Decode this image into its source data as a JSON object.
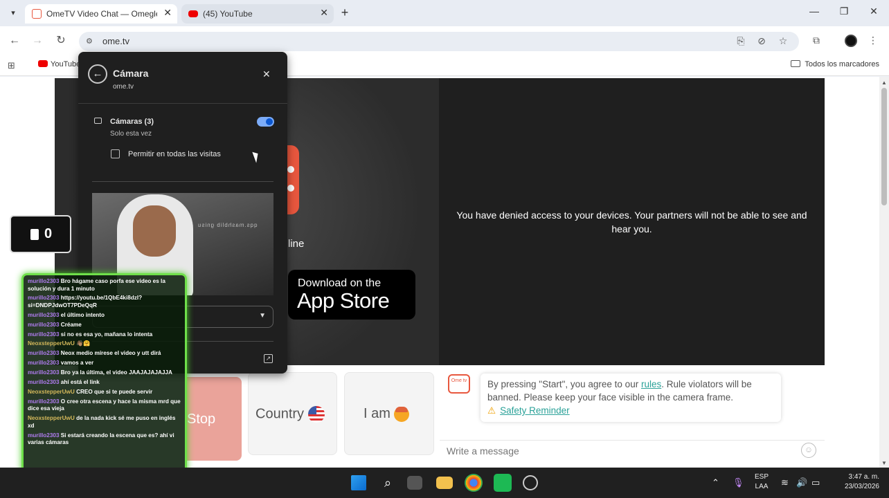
{
  "browser": {
    "tabs": [
      {
        "title": "OmeTV Video Chat — Omegle"
      },
      {
        "title": "(45) YouTube"
      }
    ],
    "url": "ome.tv",
    "bookmarks": {
      "youtube_label": "YouTube",
      "all_bookmarks": "Todos los marcadores"
    }
  },
  "permission_popup": {
    "title": "Cámara",
    "host": "ome.tv",
    "cameras_label": "Cámaras (3)",
    "cameras_sub": "Solo esta vez",
    "cameras_enabled": true,
    "allow_always_label": "Permitir en todas las visitas",
    "allow_always_checked": false,
    "preview_mirrored_text": "qqs.mashblib gnisu"
  },
  "page": {
    "denied_message": "You have denied access to your devices. Your partners will not be able to see and hear you.",
    "online_fragment": "line",
    "appstore": {
      "small": "Download on the",
      "big": "App Store"
    },
    "buttons": {
      "stop": "Stop",
      "country": "Country",
      "i_am": "I am"
    },
    "chat": {
      "logo_text": "Ome tv",
      "notice_pre": "By pressing \"Start\", you agree to our ",
      "notice_link": "rules",
      "notice_post": ". Rule violators will be banned. Please keep your face visible in the camera frame.",
      "safety_reminder": "Safety Reminder",
      "placeholder": "Write a message"
    }
  },
  "stream_overlay": {
    "counter": "0",
    "messages": [
      {
        "user": "murillo2303",
        "text": "Bro hágame caso porfa ese video es la solución y dura 1 minuto"
      },
      {
        "user": "murillo2303",
        "text": "https://youtu.be/1QbE4ki8dzI?si=DNDPJdwOT7PDeQqR"
      },
      {
        "user": "murillo2303",
        "text": "el último intento"
      },
      {
        "user": "murillo2303",
        "text": "Créame"
      },
      {
        "user": "murillo2303",
        "text": "si no es esa yo, mañana lo intenta"
      },
      {
        "user": "NeoxstepperUwU",
        "text": "👋🏽🤗"
      },
      {
        "user": "murillo2303",
        "text": "Neox medio mírese el video y utt dirá"
      },
      {
        "user": "murillo2303",
        "text": "vamos a ver"
      },
      {
        "user": "murillo2303",
        "text": "Bro ya la última, el video JAAJAJAJAJJA"
      },
      {
        "user": "murillo2303",
        "text": "ahí está el link"
      },
      {
        "user": "NeoxstepperUwU",
        "text": "CREO que si te puede servir"
      },
      {
        "user": "murillo2303",
        "text": "O cree otra escena y hace la misma mrd que dice esa vieja"
      },
      {
        "user": "NeoxstepperUwU",
        "text": "de la nada kick sé me puso en inglés xd"
      },
      {
        "user": "murillo2303",
        "text": "Si estará creando la escena que es? ahí vi varias cámaras"
      }
    ]
  },
  "taskbar": {
    "lang_top": "ESP",
    "lang_bottom": "LAA",
    "time": "3:47 a. m.",
    "date": "23/03/2026"
  },
  "colors": {
    "accent_red": "#e8573e",
    "chat_border": "#6fe04a",
    "link": "#2aa198",
    "toggle_on": "#0b57d0"
  }
}
